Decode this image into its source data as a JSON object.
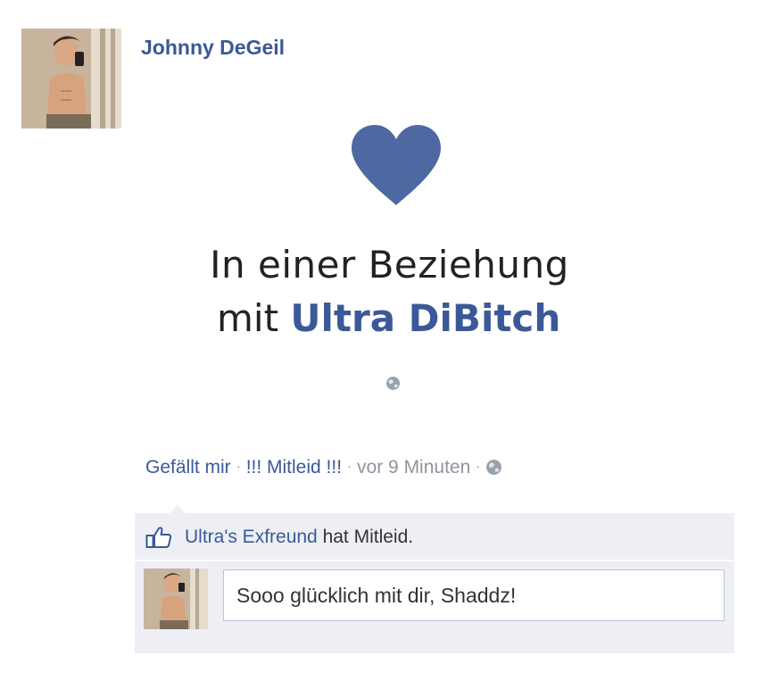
{
  "post": {
    "author_name": "Johnny DeGeil",
    "story_line1": "In einer Beziehung",
    "story_mit": "mit",
    "partner_name": "Ultra DiBitch"
  },
  "actions": {
    "like": "Gefällt mir",
    "pity": "!!! Mitleid !!!",
    "time": "vor 9 Minuten",
    "sep": "·"
  },
  "feedback": {
    "liker": "Ultra's Exfreund",
    "liked_text": " hat Mitleid."
  },
  "comment": {
    "value": "Sooo glücklich mit dir, Shaddz!"
  },
  "colors": {
    "link": "#3b5998",
    "feedback_bg": "#edeff4",
    "heart": "#4e69a2"
  },
  "icons": [
    "heart-icon",
    "globe-icon",
    "thumbs-up-icon"
  ]
}
